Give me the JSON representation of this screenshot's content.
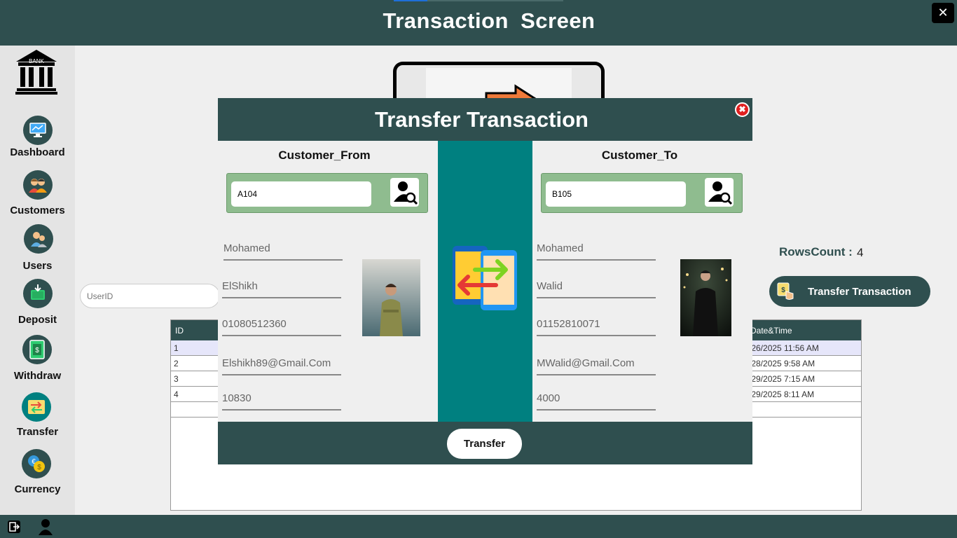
{
  "header": {
    "title": "Transaction  Screen",
    "close_glyph": "✕"
  },
  "sidebar": {
    "logo_text": "BANK",
    "items": [
      {
        "label": "Dashboard",
        "icon": "dashboard-icon"
      },
      {
        "label": "Customers",
        "icon": "customers-icon"
      },
      {
        "label": "Users",
        "icon": "users-icon"
      },
      {
        "label": "Deposit",
        "icon": "deposit-icon"
      },
      {
        "label": "Withdraw",
        "icon": "withdraw-icon"
      },
      {
        "label": "Transfer",
        "icon": "transfer-icon"
      },
      {
        "label": "Currency",
        "icon": "currency-icon"
      }
    ]
  },
  "background": {
    "userid_placeholder": "UserID",
    "rows_count_label": "RowsCount :",
    "rows_count_value": "4",
    "transfer_transaction_button": "Transfer Transaction",
    "grid": {
      "columns": [
        "ID",
        "Date&Time"
      ],
      "rows": [
        {
          "id": "1",
          "datetime": "/26/2025 11:56 AM"
        },
        {
          "id": "2",
          "datetime": "/28/2025 9:58 AM"
        },
        {
          "id": "3",
          "datetime": "/29/2025 7:15 AM"
        },
        {
          "id": "4",
          "datetime": "/29/2025 8:11 AM"
        }
      ]
    }
  },
  "dialog": {
    "title": "Transfer Transaction",
    "close_glyph": "✖",
    "from": {
      "title": "Customer_From",
      "search_value": "A104",
      "first_name": "Mohamed",
      "last_name": "ElShikh",
      "phone": "01080512360",
      "email": "Elshikh89@Gmail.Com",
      "balance": "10830"
    },
    "to": {
      "title": "Customer_To",
      "search_value": "B105",
      "first_name": "Mohamed",
      "last_name": "Walid",
      "phone": "01152810071",
      "email": "MWalid@Gmail.Com",
      "balance": "4000"
    },
    "transfer_button": "Transfer"
  },
  "colors": {
    "primary": "#2f4f4f",
    "teal": "#008080",
    "search_panel": "#8fbc8f",
    "close_red": "#e02020"
  }
}
